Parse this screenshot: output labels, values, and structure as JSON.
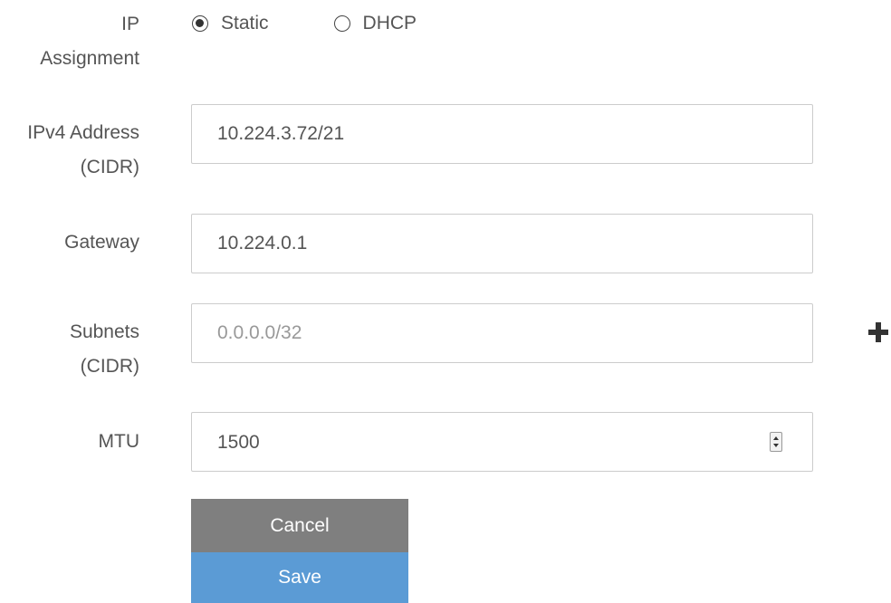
{
  "ip_assignment": {
    "label_line1": "IP",
    "label_line2": "Assignment",
    "options": [
      {
        "label": "Static",
        "checked": true
      },
      {
        "label": "DHCP",
        "checked": false
      }
    ]
  },
  "ipv4": {
    "label_line1": "IPv4 Address",
    "label_line2": "(CIDR)",
    "value": "10.224.3.72/21"
  },
  "gateway": {
    "label": "Gateway",
    "value": "10.224.0.1"
  },
  "subnets": {
    "label_line1": "Subnets",
    "label_line2": "(CIDR)",
    "value": "",
    "placeholder": "0.0.0.0/32",
    "add_icon": "plus-icon"
  },
  "mtu": {
    "label": "MTU",
    "value": "1500",
    "spinner_icon": "spinner-updown-icon"
  },
  "buttons": {
    "cancel": "Cancel",
    "save": "Save"
  }
}
